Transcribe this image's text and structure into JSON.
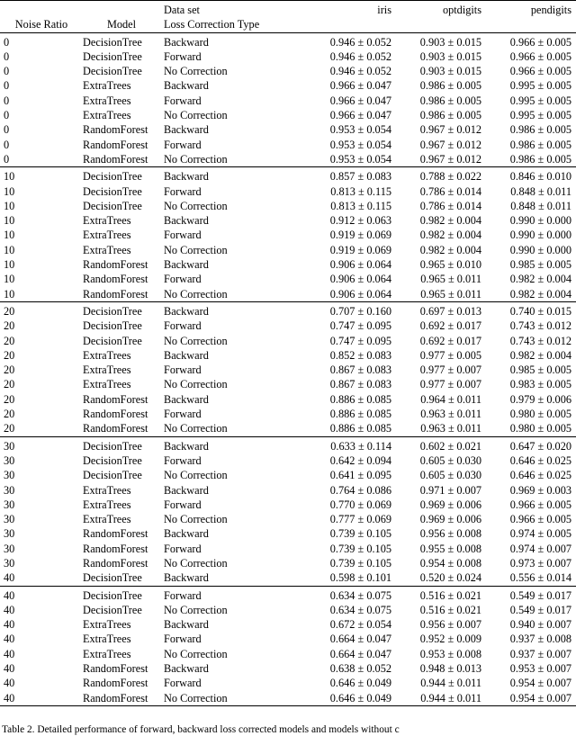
{
  "table": {
    "header": {
      "col_noise_ratio": "Noise Ratio",
      "col_model": "Model",
      "stack_line1": "Data set",
      "stack_line2": "Loss Correction Type",
      "datasets": [
        "iris",
        "optdigits",
        "pendigits"
      ]
    },
    "blocks": [
      {
        "rows": [
          {
            "noise": "0",
            "model": "DecisionTree",
            "loss": "Backward",
            "iris": "0.946 ± 0.052",
            "optdigits": "0.903 ± 0.015",
            "pendigits": "0.966 ± 0.005"
          },
          {
            "noise": "0",
            "model": "DecisionTree",
            "loss": "Forward",
            "iris": "0.946 ± 0.052",
            "optdigits": "0.903 ± 0.015",
            "pendigits": "0.966 ± 0.005"
          },
          {
            "noise": "0",
            "model": "DecisionTree",
            "loss": "No Correction",
            "iris": "0.946 ± 0.052",
            "optdigits": "0.903 ± 0.015",
            "pendigits": "0.966 ± 0.005"
          },
          {
            "noise": "0",
            "model": "ExtraTrees",
            "loss": "Backward",
            "iris": "0.966 ± 0.047",
            "optdigits": "0.986 ± 0.005",
            "pendigits": "0.995 ± 0.005"
          },
          {
            "noise": "0",
            "model": "ExtraTrees",
            "loss": "Forward",
            "iris": "0.966 ± 0.047",
            "optdigits": "0.986 ± 0.005",
            "pendigits": "0.995 ± 0.005"
          },
          {
            "noise": "0",
            "model": "ExtraTrees",
            "loss": "No Correction",
            "iris": "0.966 ± 0.047",
            "optdigits": "0.986 ± 0.005",
            "pendigits": "0.995 ± 0.005"
          },
          {
            "noise": "0",
            "model": "RandomForest",
            "loss": "Backward",
            "iris": "0.953 ± 0.054",
            "optdigits": "0.967 ± 0.012",
            "pendigits": "0.986 ± 0.005"
          },
          {
            "noise": "0",
            "model": "RandomForest",
            "loss": "Forward",
            "iris": "0.953 ± 0.054",
            "optdigits": "0.967 ± 0.012",
            "pendigits": "0.986 ± 0.005"
          },
          {
            "noise": "0",
            "model": "RandomForest",
            "loss": "No Correction",
            "iris": "0.953 ± 0.054",
            "optdigits": "0.967 ± 0.012",
            "pendigits": "0.986 ± 0.005"
          }
        ]
      },
      {
        "rows": [
          {
            "noise": "10",
            "model": "DecisionTree",
            "loss": "Backward",
            "iris": "0.857 ± 0.083",
            "optdigits": "0.788 ± 0.022",
            "pendigits": "0.846 ± 0.010"
          },
          {
            "noise": "10",
            "model": "DecisionTree",
            "loss": "Forward",
            "iris": "0.813 ± 0.115",
            "optdigits": "0.786 ± 0.014",
            "pendigits": "0.848 ± 0.011"
          },
          {
            "noise": "10",
            "model": "DecisionTree",
            "loss": "No Correction",
            "iris": "0.813 ± 0.115",
            "optdigits": "0.786 ± 0.014",
            "pendigits": "0.848 ± 0.011"
          },
          {
            "noise": "10",
            "model": "ExtraTrees",
            "loss": "Backward",
            "iris": "0.912 ± 0.063",
            "optdigits": "0.982 ± 0.004",
            "pendigits": "0.990 ± 0.000"
          },
          {
            "noise": "10",
            "model": "ExtraTrees",
            "loss": "Forward",
            "iris": "0.919 ± 0.069",
            "optdigits": "0.982 ± 0.004",
            "pendigits": "0.990 ± 0.000"
          },
          {
            "noise": "10",
            "model": "ExtraTrees",
            "loss": "No Correction",
            "iris": "0.919 ± 0.069",
            "optdigits": "0.982 ± 0.004",
            "pendigits": "0.990 ± 0.000"
          },
          {
            "noise": "10",
            "model": "RandomForest",
            "loss": "Backward",
            "iris": "0.906 ± 0.064",
            "optdigits": "0.965 ± 0.010",
            "pendigits": "0.985 ± 0.005"
          },
          {
            "noise": "10",
            "model": "RandomForest",
            "loss": "Forward",
            "iris": "0.906 ± 0.064",
            "optdigits": "0.965 ± 0.011",
            "pendigits": "0.982 ± 0.004"
          },
          {
            "noise": "10",
            "model": "RandomForest",
            "loss": "No Correction",
            "iris": "0.906 ± 0.064",
            "optdigits": "0.965 ± 0.011",
            "pendigits": "0.982 ± 0.004"
          }
        ]
      },
      {
        "rows": [
          {
            "noise": "20",
            "model": "DecisionTree",
            "loss": "Backward",
            "iris": "0.707 ± 0.160",
            "optdigits": "0.697 ± 0.013",
            "pendigits": "0.740 ± 0.015"
          },
          {
            "noise": "20",
            "model": "DecisionTree",
            "loss": "Forward",
            "iris": "0.747 ± 0.095",
            "optdigits": "0.692 ± 0.017",
            "pendigits": "0.743 ± 0.012"
          },
          {
            "noise": "20",
            "model": "DecisionTree",
            "loss": "No Correction",
            "iris": "0.747 ± 0.095",
            "optdigits": "0.692 ± 0.017",
            "pendigits": "0.743 ± 0.012"
          },
          {
            "noise": "20",
            "model": "ExtraTrees",
            "loss": "Backward",
            "iris": "0.852 ± 0.083",
            "optdigits": "0.977 ± 0.005",
            "pendigits": "0.982 ± 0.004"
          },
          {
            "noise": "20",
            "model": "ExtraTrees",
            "loss": "Forward",
            "iris": "0.867 ± 0.083",
            "optdigits": "0.977 ± 0.007",
            "pendigits": "0.985 ± 0.005"
          },
          {
            "noise": "20",
            "model": "ExtraTrees",
            "loss": "No Correction",
            "iris": "0.867 ± 0.083",
            "optdigits": "0.977 ± 0.007",
            "pendigits": "0.983 ± 0.005"
          },
          {
            "noise": "20",
            "model": "RandomForest",
            "loss": "Backward",
            "iris": "0.886 ± 0.085",
            "optdigits": "0.964 ± 0.011",
            "pendigits": "0.979 ± 0.006"
          },
          {
            "noise": "20",
            "model": "RandomForest",
            "loss": "Forward",
            "iris": "0.886 ± 0.085",
            "optdigits": "0.963 ± 0.011",
            "pendigits": "0.980 ± 0.005"
          },
          {
            "noise": "20",
            "model": "RandomForest",
            "loss": "No Correction",
            "iris": "0.886 ± 0.085",
            "optdigits": "0.963 ± 0.011",
            "pendigits": "0.980 ± 0.005"
          }
        ]
      },
      {
        "rows": [
          {
            "noise": "30",
            "model": "DecisionTree",
            "loss": "Backward",
            "iris": "0.633 ± 0.114",
            "optdigits": "0.602 ± 0.021",
            "pendigits": "0.647 ± 0.020"
          },
          {
            "noise": "30",
            "model": "DecisionTree",
            "loss": "Forward",
            "iris": "0.642 ± 0.094",
            "optdigits": "0.605 ± 0.030",
            "pendigits": "0.646 ± 0.025"
          },
          {
            "noise": "30",
            "model": "DecisionTree",
            "loss": "No Correction",
            "iris": "0.641 ± 0.095",
            "optdigits": "0.605 ± 0.030",
            "pendigits": "0.646 ± 0.025"
          },
          {
            "noise": "30",
            "model": "ExtraTrees",
            "loss": "Backward",
            "iris": "0.764 ± 0.086",
            "optdigits": "0.971 ± 0.007",
            "pendigits": "0.969 ± 0.003"
          },
          {
            "noise": "30",
            "model": "ExtraTrees",
            "loss": "Forward",
            "iris": "0.770 ± 0.069",
            "optdigits": "0.969 ± 0.006",
            "pendigits": "0.966 ± 0.005"
          },
          {
            "noise": "30",
            "model": "ExtraTrees",
            "loss": "No Correction",
            "iris": "0.777 ± 0.069",
            "optdigits": "0.969 ± 0.006",
            "pendigits": "0.966 ± 0.005"
          },
          {
            "noise": "30",
            "model": "RandomForest",
            "loss": "Backward",
            "iris": "0.739 ± 0.105",
            "optdigits": "0.956 ± 0.008",
            "pendigits": "0.974 ± 0.005"
          },
          {
            "noise": "30",
            "model": "RandomForest",
            "loss": "Forward",
            "iris": "0.739 ± 0.105",
            "optdigits": "0.955 ± 0.008",
            "pendigits": "0.974 ± 0.007"
          },
          {
            "noise": "30",
            "model": "RandomForest",
            "loss": "No Correction",
            "iris": "0.739 ± 0.105",
            "optdigits": "0.954 ± 0.008",
            "pendigits": "0.973 ± 0.007"
          },
          {
            "noise": "40",
            "model": "DecisionTree",
            "loss": "Backward",
            "iris": "0.598 ± 0.101",
            "optdigits": "0.520 ± 0.024",
            "pendigits": "0.556 ± 0.014"
          }
        ]
      },
      {
        "rows": [
          {
            "noise": "40",
            "model": "DecisionTree",
            "loss": "Forward",
            "iris": "0.634 ± 0.075",
            "optdigits": "0.516 ± 0.021",
            "pendigits": "0.549 ± 0.017"
          },
          {
            "noise": "40",
            "model": "DecisionTree",
            "loss": "No Correction",
            "iris": "0.634 ± 0.075",
            "optdigits": "0.516 ± 0.021",
            "pendigits": "0.549 ± 0.017"
          },
          {
            "noise": "40",
            "model": "ExtraTrees",
            "loss": "Backward",
            "iris": "0.672 ± 0.054",
            "optdigits": "0.956 ± 0.007",
            "pendigits": "0.940 ± 0.007"
          },
          {
            "noise": "40",
            "model": "ExtraTrees",
            "loss": "Forward",
            "iris": "0.664 ± 0.047",
            "optdigits": "0.952 ± 0.009",
            "pendigits": "0.937 ± 0.008"
          },
          {
            "noise": "40",
            "model": "ExtraTrees",
            "loss": "No Correction",
            "iris": "0.664 ± 0.047",
            "optdigits": "0.953 ± 0.008",
            "pendigits": "0.937 ± 0.007"
          },
          {
            "noise": "40",
            "model": "RandomForest",
            "loss": "Backward",
            "iris": "0.638 ± 0.052",
            "optdigits": "0.948 ± 0.013",
            "pendigits": "0.953 ± 0.007"
          },
          {
            "noise": "40",
            "model": "RandomForest",
            "loss": "Forward",
            "iris": "0.646 ± 0.049",
            "optdigits": "0.944 ± 0.011",
            "pendigits": "0.954 ± 0.007"
          },
          {
            "noise": "40",
            "model": "RandomForest",
            "loss": "No Correction",
            "iris": "0.646 ± 0.049",
            "optdigits": "0.944 ± 0.011",
            "pendigits": "0.954 ± 0.007"
          }
        ]
      }
    ]
  },
  "caption": "Table 2. Detailed performance of forward, backward loss corrected models and models without c"
}
